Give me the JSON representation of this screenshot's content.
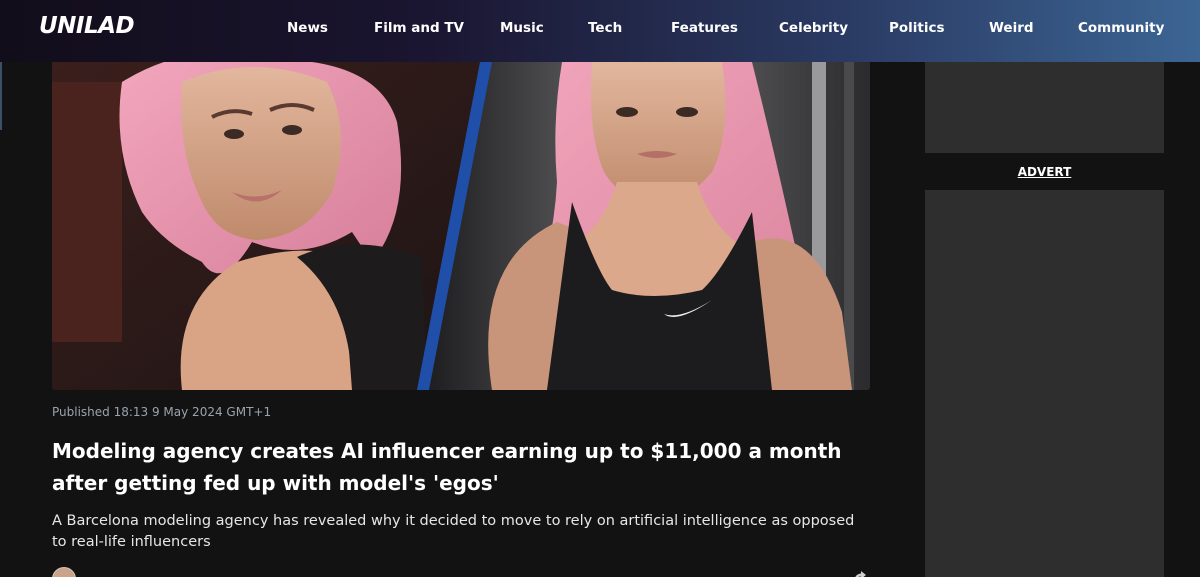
{
  "site": {
    "logo": "UNILAD"
  },
  "nav": {
    "items": [
      "News",
      "Film and TV",
      "Music",
      "Tech",
      "Features",
      "Celebrity",
      "Politics",
      "Weird",
      "Community"
    ]
  },
  "article": {
    "published": "Published 18:13 9 May 2024 GMT+1",
    "headline": "Modeling agency creates AI influencer earning up to $11,000 a month after getting fed up with model's 'egos'",
    "summary": "A Barcelona modeling agency has revealed why it decided to move to rely on artificial intelligence as opposed to real-life influencers",
    "hero_image": "two-photos-pink-haired-woman"
  },
  "sidebar": {
    "advert_label": "ADVERT"
  },
  "colors": {
    "header_start": "#120d1a",
    "header_end": "#3c6594",
    "background": "#121212",
    "ad_block": "#2e2e2e",
    "divider_blue": "#1f4fa8"
  }
}
